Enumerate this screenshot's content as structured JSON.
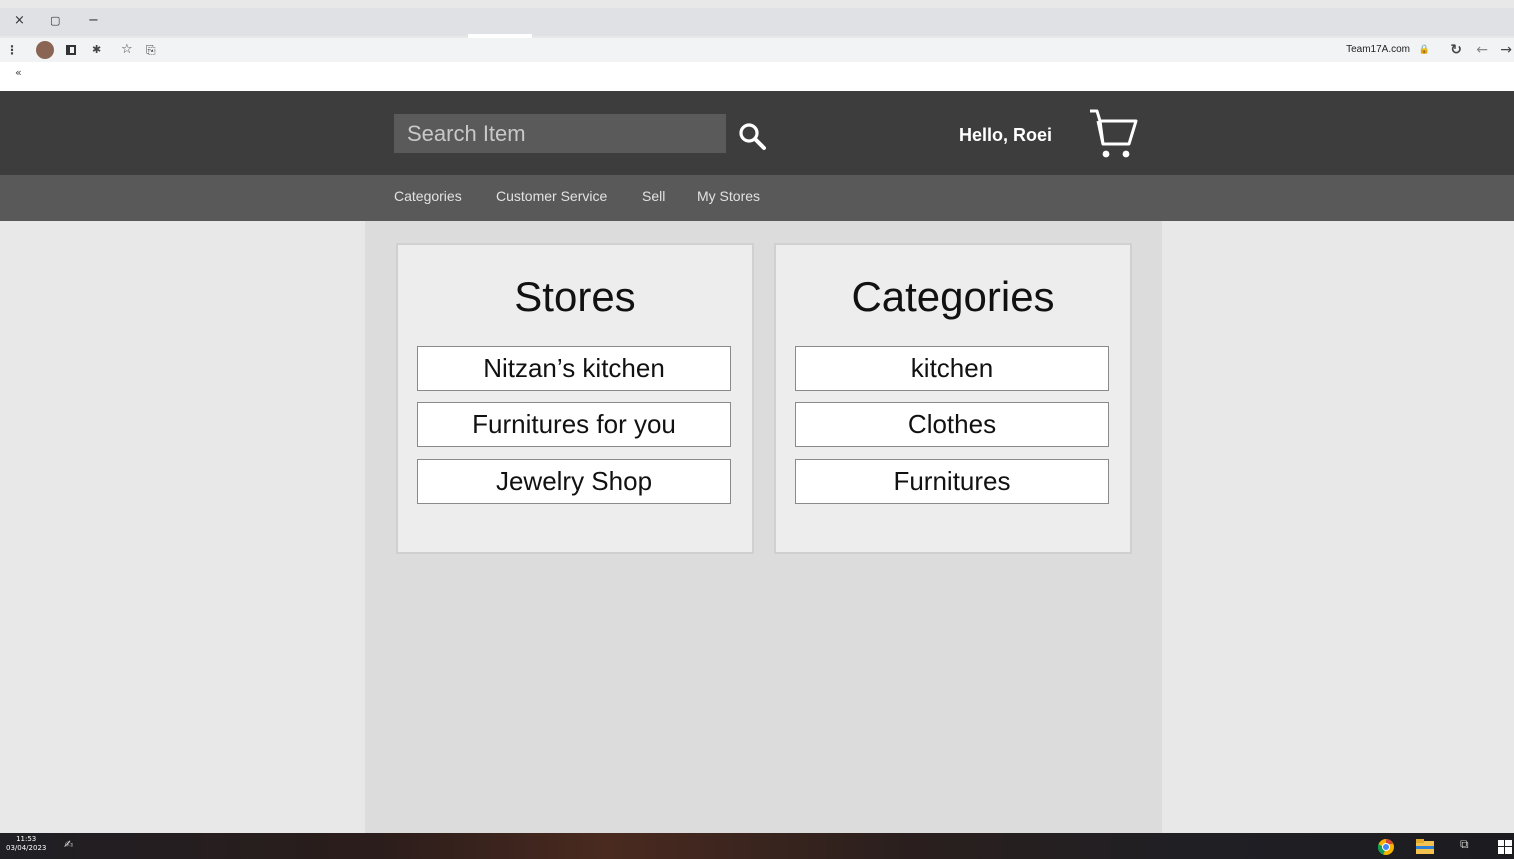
{
  "browser": {
    "window_controls": {
      "close": "×",
      "restore": "▢",
      "minimize": "−"
    },
    "url": "Team17A.com",
    "bookmarks_chevron": "«"
  },
  "header": {
    "search": {
      "placeholder": "Search Item"
    },
    "greeting": "Hello, Roei"
  },
  "nav": {
    "items": [
      "Categories",
      "Customer Service",
      "Sell",
      "My Stores"
    ]
  },
  "stores": {
    "title": "Stores",
    "items": [
      "Nitzan’s kitchen",
      "Furnitures for you",
      "Jewelry Shop"
    ]
  },
  "categories": {
    "title": "Categories",
    "items": [
      "kitchen",
      "Clothes",
      "Furnitures"
    ]
  },
  "taskbar": {
    "time": "11:53",
    "date": "03/04/2023"
  },
  "colors": {
    "header_bg": "#3d3d3d",
    "nav_bg": "#595959",
    "content_bg": "#dcdcdc",
    "panel_bg": "#ededed"
  }
}
